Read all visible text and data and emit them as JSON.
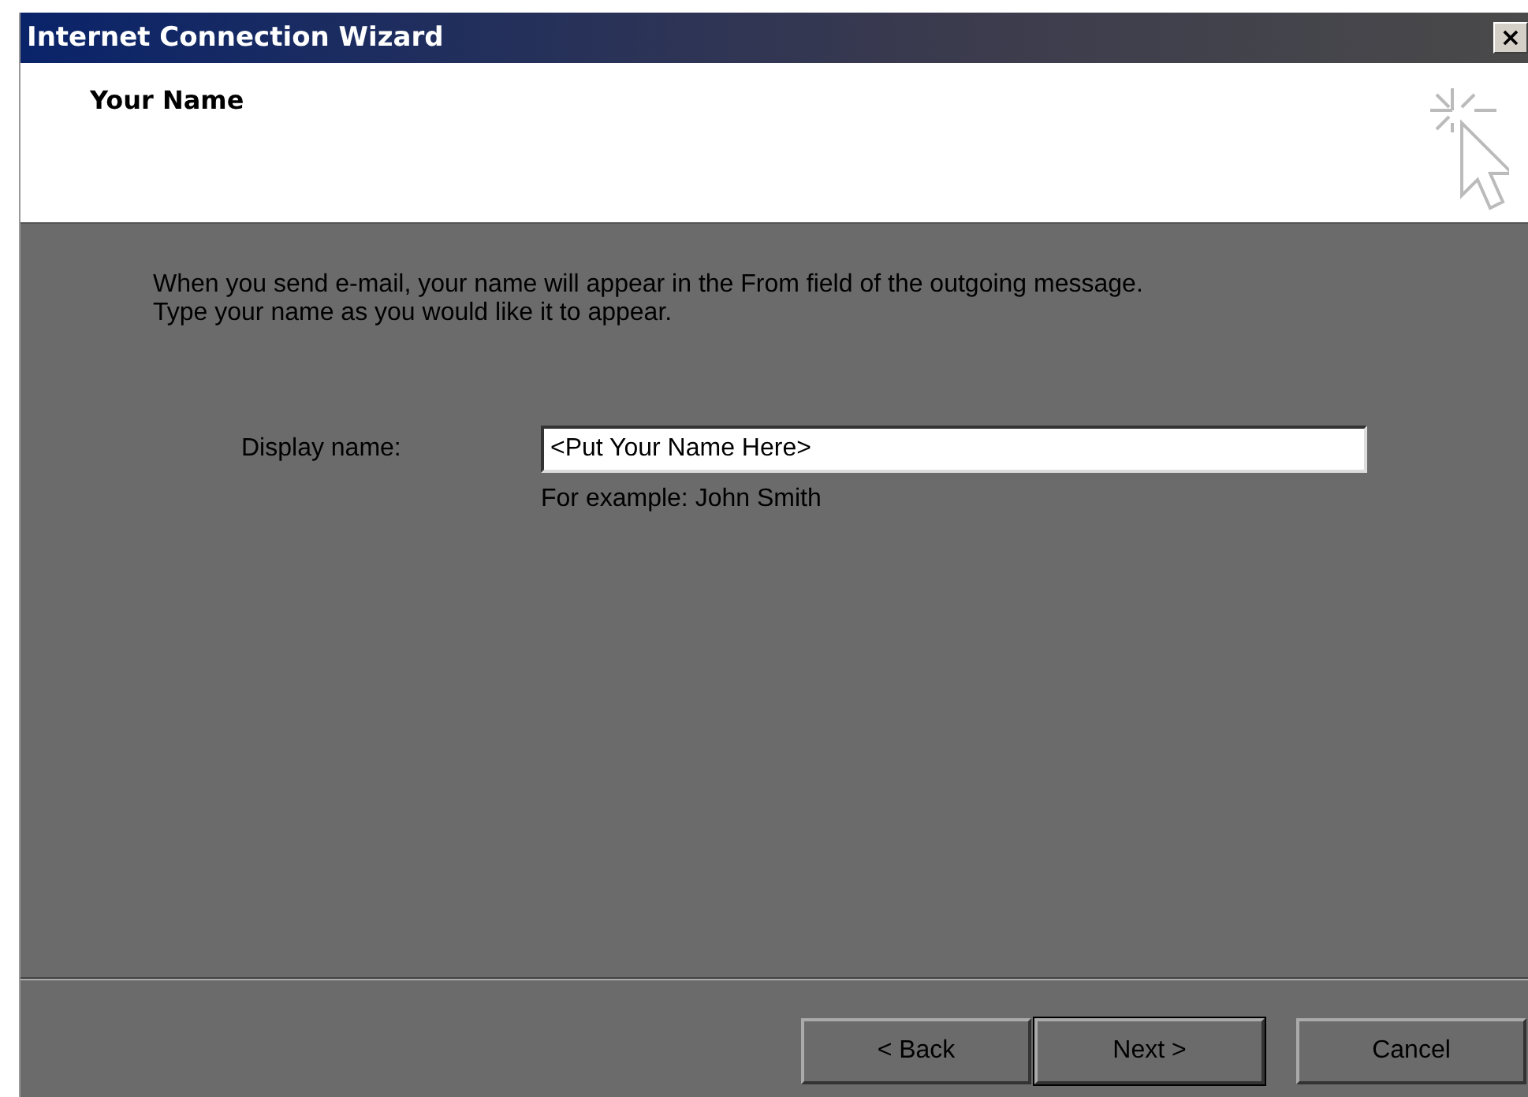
{
  "window": {
    "title": "Internet Connection Wizard",
    "close": "×"
  },
  "header": {
    "title": "Your Name"
  },
  "intro": [
    "When you send e-mail, your name will appear in the From field of the outgoing message.",
    "Type your name as you would like it to appear."
  ],
  "field": {
    "label": "Display name:",
    "value": "<Put Your Name Here>",
    "hint": "For example: John Smith"
  },
  "buttons": [
    {
      "label": "< Back",
      "default": false
    },
    {
      "label": "Next >",
      "default": true
    },
    {
      "label": "Cancel",
      "default": false
    }
  ]
}
